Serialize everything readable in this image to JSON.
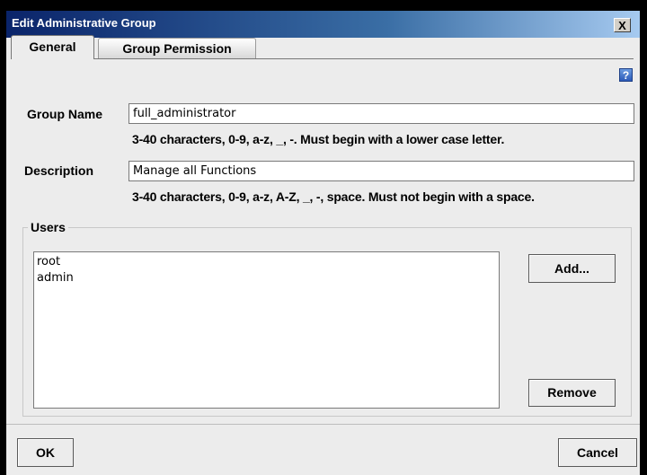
{
  "window": {
    "title": "Edit Administrative Group",
    "close_label": "X"
  },
  "tabs": [
    {
      "label": "General",
      "active": true
    },
    {
      "label": "Group Permission",
      "active": false
    }
  ],
  "help": {
    "icon": "help-question-icon",
    "label": "?"
  },
  "form": {
    "group_name": {
      "label": "Group Name",
      "value": "full_administrator",
      "hint": "3-40 characters, 0-9, a-z, _, -. Must begin with a lower case letter."
    },
    "description": {
      "label": "Description",
      "value": "Manage all Functions",
      "hint": "3-40 characters, 0-9, a-z, A-Z, _, -, space. Must not begin with a space."
    }
  },
  "users": {
    "legend": "Users",
    "items": [
      "root",
      "admin"
    ],
    "add_label": "Add...",
    "remove_label": "Remove"
  },
  "footer": {
    "ok_label": "OK",
    "cancel_label": "Cancel"
  },
  "colors": {
    "title_start": "#0a246a",
    "title_end": "#a6caf0",
    "dialog_bg": "#ececec"
  }
}
